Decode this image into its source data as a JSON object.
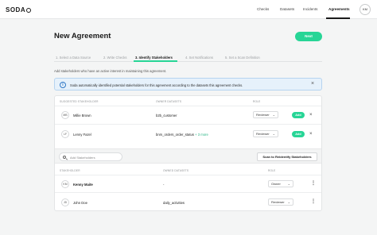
{
  "app": {
    "logo": "SODA"
  },
  "nav": {
    "items": [
      "Checks",
      "Datasets",
      "Incidents",
      "Agreements"
    ],
    "active": "Agreements",
    "user_initials": "KM"
  },
  "page": {
    "title": "New Agreement",
    "next_label": "Next"
  },
  "steps": [
    "1. Select a Data Source",
    "2. Write Checks",
    "3. Identify Stakeholders",
    "4. Set Notifications",
    "5. Set a Scan Definition"
  ],
  "active_step": "3. Identify Stakeholders",
  "helper_text": "Add stakeholders who have an active interest in maintaining this agreement.",
  "banner": {
    "text": "Soda automatically identified potential stakeholders for this agreement according to the datasets this agreement checks.",
    "icon": "info-icon",
    "close_icon": "close-icon"
  },
  "suggested": {
    "headers": [
      "SUGGESTED STAKEHOLDER",
      "OWNER DATASETS",
      "ROLE"
    ],
    "rows": [
      {
        "initials": "MB",
        "name": "Millie Brown",
        "datasets": "b2b_customer",
        "more": "",
        "role": "Reviewer",
        "add": "Add"
      },
      {
        "initials": "LF",
        "name": "Lenny Fazel",
        "datasets": "bnm_orders_order_status",
        "more": "+ 3 more",
        "role": "Reviewer",
        "add": "Add"
      }
    ]
  },
  "search": {
    "placeholder": "Add Stakeholders",
    "scan_label": "Scan to Reidentify Stakeholders"
  },
  "stakeholders": {
    "headers": [
      "STAKEHOLDER",
      "OWNED DATASETS",
      "ROLE"
    ],
    "rows": [
      {
        "initials": "KM",
        "name": "Kenny Maite",
        "datasets": "-",
        "role": "Owner"
      },
      {
        "initials": "JD",
        "name": "John Doe",
        "datasets": "daily_activities",
        "role": "Reviewer"
      }
    ]
  },
  "colors": {
    "accent": "#27d596",
    "banner_bg": "#e6f1fb",
    "banner_border": "#b6d4f0"
  }
}
